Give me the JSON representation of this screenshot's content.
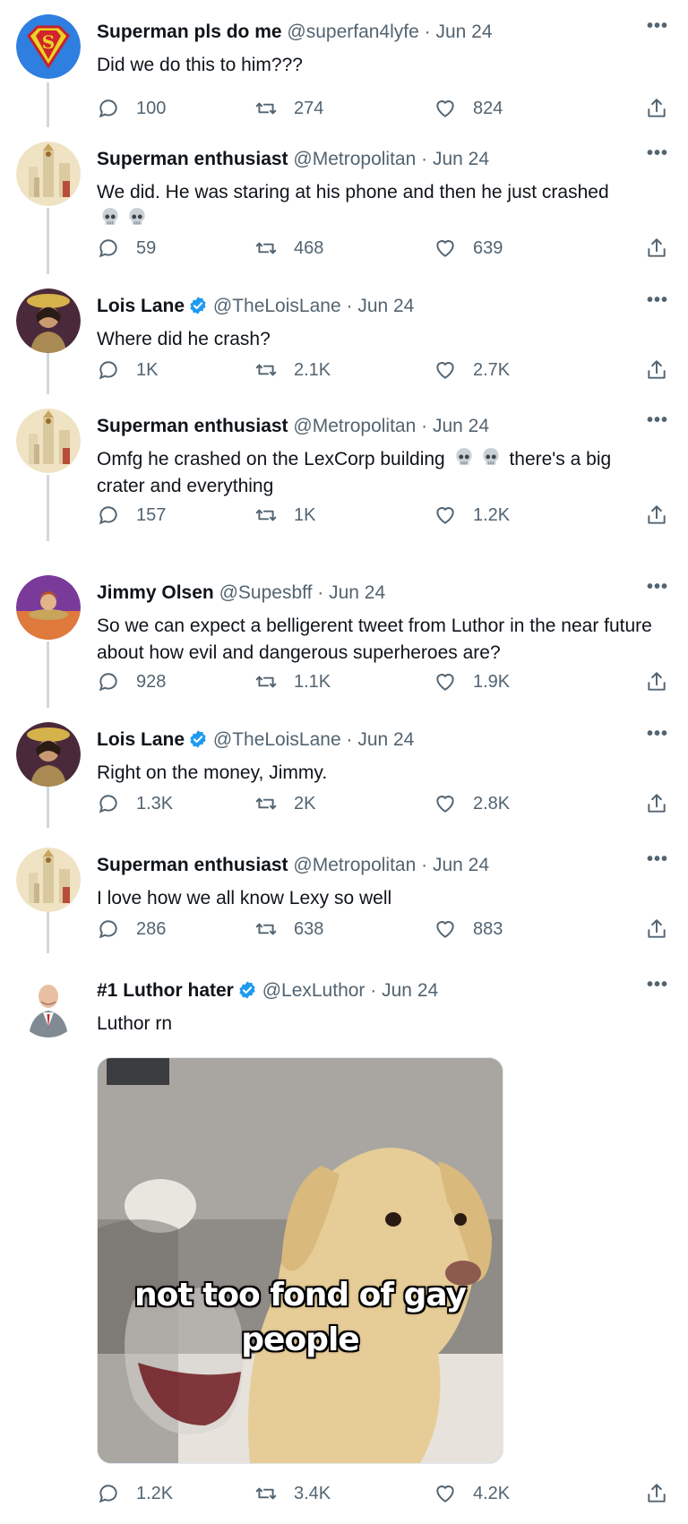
{
  "tweets": [
    {
      "name": "Superman pls do me",
      "handle": "@superfan4lyfe",
      "date": "Jun 24",
      "verified": false,
      "avatar": "superman-logo",
      "text": "Did we do this to him???",
      "replies": "100",
      "retweets": "274",
      "likes": "824"
    },
    {
      "name": "Superman enthusiast",
      "handle": "@Metropolitan",
      "date": "Jun 24",
      "verified": false,
      "avatar": "metropolis-city",
      "text": "We did. He was staring at his phone and then he just crashed",
      "emoji": "💀💀",
      "replies": "59",
      "retweets": "468",
      "likes": "639"
    },
    {
      "name": "Lois Lane",
      "handle": "@TheLoisLane",
      "date": "Jun 24",
      "verified": true,
      "avatar": "lois-portrait",
      "text": "Where did he crash?",
      "replies": "1K",
      "retweets": "2.1K",
      "likes": "2.7K"
    },
    {
      "name": "Superman enthusiast",
      "handle": "@Metropolitan",
      "date": "Jun 24",
      "verified": false,
      "avatar": "metropolis-city",
      "text_before": "Omfg he crashed on the LexCorp building",
      "emoji": "💀💀",
      "text_after": "there's a big crater and everything",
      "replies": "157",
      "retweets": "1K",
      "likes": "1.2K"
    },
    {
      "name": "Jimmy Olsen",
      "handle": "@Supesbff",
      "date": "Jun 24",
      "verified": false,
      "avatar": "jimmy-portrait",
      "text": "So we can expect a belligerent tweet from Luthor in the near future about how evil and dangerous superheroes are?",
      "replies": "928",
      "retweets": "1.1K",
      "likes": "1.9K"
    },
    {
      "name": "Lois Lane",
      "handle": "@TheLoisLane",
      "date": "Jun 24",
      "verified": true,
      "avatar": "lois-portrait",
      "text": "Right on the money, Jimmy.",
      "replies": "1.3K",
      "retweets": "2K",
      "likes": "2.8K"
    },
    {
      "name": "Superman enthusiast",
      "handle": "@Metropolitan",
      "date": "Jun 24",
      "verified": false,
      "avatar": "metropolis-city",
      "text": "I love how we all know Lexy so well",
      "replies": "286",
      "retweets": "638",
      "likes": "883"
    },
    {
      "name": "#1 Luthor hater",
      "handle": "@LexLuthor",
      "date": "Jun 24",
      "verified": true,
      "avatar": "lex-portrait",
      "text": "Luthor rn",
      "media_caption_line1": "not too fond of gay",
      "media_caption_line2": "people",
      "replies": "1.2K",
      "retweets": "3.4K",
      "likes": "4.2K"
    }
  ],
  "ui": {
    "dot": "·",
    "more": "•••"
  },
  "icons": {
    "reply": "reply-icon",
    "retweet": "retweet-icon",
    "like": "like-icon",
    "share": "share-icon",
    "verified": "verified-badge-icon"
  },
  "colors": {
    "text": "#0f1419",
    "muted": "#536471",
    "verified": "#1d9bf0",
    "thread_line": "#cfd9de"
  }
}
